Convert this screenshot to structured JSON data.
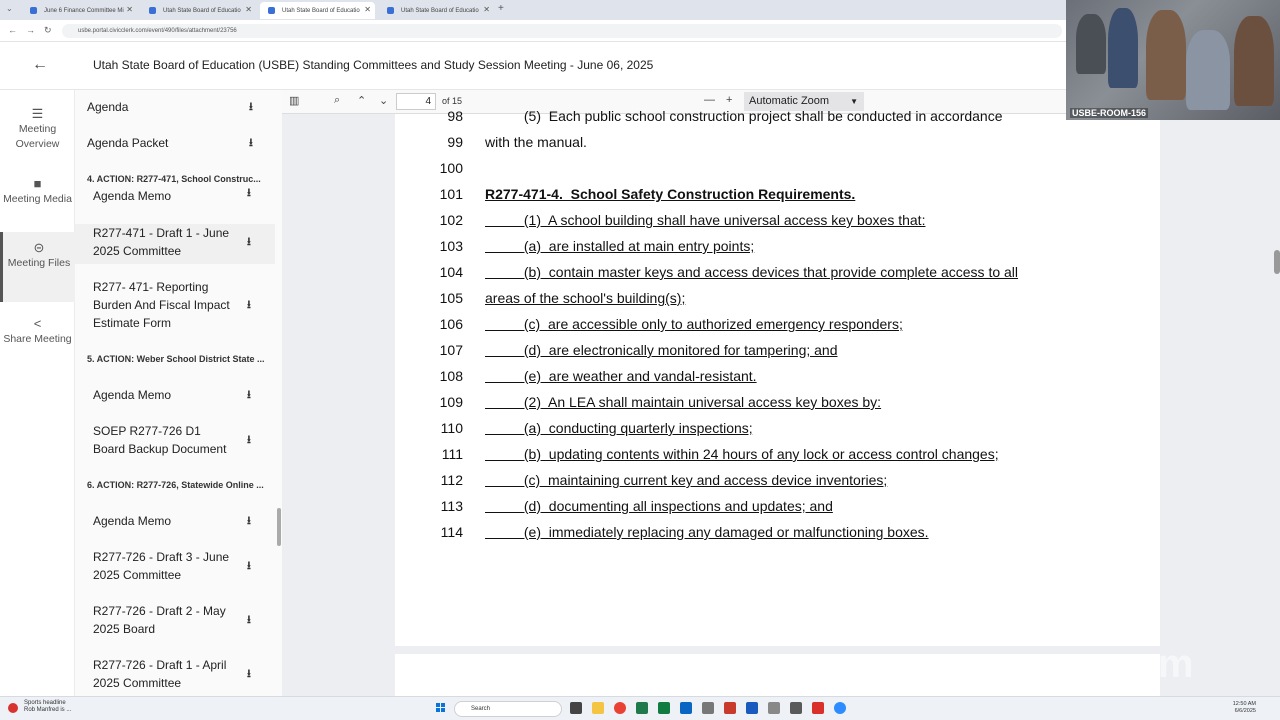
{
  "browser": {
    "tabs": [
      {
        "label": "June 6 Finance Committee Mi",
        "active": false
      },
      {
        "label": "Utah State Board of Educatio",
        "active": false
      },
      {
        "label": "Utah State Board of Educatio",
        "active": true
      },
      {
        "label": "Utah State Board of Educatio",
        "active": false
      }
    ],
    "url": "usbe.portal.civicclerk.com/event/490/files/attachment/23756"
  },
  "header": {
    "title": "Utah State Board of Education (USBE) Standing Committees and Study Session Meeting - June 06, 2025"
  },
  "rail": [
    {
      "label": "Meeting Overview",
      "icon": "list-icon"
    },
    {
      "label": "Meeting Media",
      "icon": "video-icon"
    },
    {
      "label": "Meeting Files",
      "icon": "link-icon",
      "active": true
    },
    {
      "label": "Share Meeting",
      "icon": "share-icon"
    }
  ],
  "files": {
    "agenda": "Agenda",
    "agenda_packet": "Agenda Packet",
    "sections": [
      "4. ACTION: R277-471, School Construc...",
      "5. ACTION: Weber School District State ...",
      "6. ACTION: R277-726, Statewide Online ..."
    ],
    "items": [
      "Agenda Memo",
      "R277-471 - Draft 1 - June 2025 Committee",
      "R277- 471- Reporting Burden And Fiscal Impact Estimate Form",
      "Agenda Memo",
      "SOEP R277-726 D1 Board Backup Document",
      "Agenda Memo",
      "R277-726 - Draft 3 - June 2025 Committee",
      "R277-726 - Draft 2 - May 2025 Board",
      "R277-726 - Draft 1 - April 2025 Committee"
    ]
  },
  "viewer": {
    "page_number": "4",
    "page_total": "of 15",
    "zoom": "Automatic Zoom",
    "lines": [
      {
        "n": "98",
        "t": "          (5)  Each public school construction project shall be conducted in accordance",
        "style": ""
      },
      {
        "n": "99",
        "t": "with the manual.",
        "style": ""
      },
      {
        "n": "100",
        "t": "",
        "style": ""
      },
      {
        "n": "101",
        "t": "R277-471-4.  School Safety Construction Requirements.",
        "style": "ub"
      },
      {
        "n": "102",
        "t": "          (1)  A school building shall have universal access key boxes that:",
        "style": "u"
      },
      {
        "n": "103",
        "t": "          (a)  are installed at main entry points;",
        "style": "u"
      },
      {
        "n": "104",
        "t": "          (b)  contain master keys and access devices that provide complete access to all",
        "style": "u"
      },
      {
        "n": "105",
        "t": "areas of the school's building(s);",
        "style": "u"
      },
      {
        "n": "106",
        "t": "          (c)  are accessible only to authorized emergency responders;",
        "style": "u"
      },
      {
        "n": "107",
        "t": "          (d)  are electronically monitored for tampering; and",
        "style": "u"
      },
      {
        "n": "108",
        "t": "          (e)  are weather and vandal-resistant.",
        "style": "u"
      },
      {
        "n": "109",
        "t": "          (2)  An LEA shall maintain universal access key boxes by:",
        "style": "u"
      },
      {
        "n": "110",
        "t": "          (a)  conducting quarterly inspections;",
        "style": "u"
      },
      {
        "n": "111",
        "t": "          (b)  updating contents within 24 hours of any lock or access control changes;",
        "style": "u"
      },
      {
        "n": "112",
        "t": "          (c)  maintaining current key and access device inventories;",
        "style": "u"
      },
      {
        "n": "113",
        "t": "          (d)  documenting all inspections and updates; and",
        "style": "u"
      },
      {
        "n": "114",
        "t": "          (e)  immediately replacing any damaged or malfunctioning boxes.",
        "style": "u"
      }
    ]
  },
  "video": {
    "room_label": "USBE-ROOM-156"
  },
  "taskbar": {
    "news_title": "Sports headline",
    "news_sub": "Rob Manfred is ...",
    "search_placeholder": "Search",
    "time": "12:50 AM",
    "date": "6/6/2025"
  }
}
